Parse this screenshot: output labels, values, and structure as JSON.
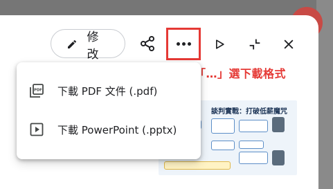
{
  "toolbar": {
    "edit_label": "修改",
    "icons": [
      "pencil-icon",
      "share-icon",
      "more-icon",
      "play-icon",
      "minimize-icon",
      "close-icon"
    ]
  },
  "annotation": "點擊「…」選下載格式",
  "menu": {
    "items": [
      {
        "label": "下載 PDF 文件 (.pdf)",
        "icon": "pdf-icon"
      },
      {
        "label": "下載 PowerPoint (.pptx)",
        "icon": "slideshow-icon"
      }
    ]
  },
  "slide": {
    "title": "談判實戰：打破低薪魔咒"
  },
  "colors": {
    "accent_red": "#e53935",
    "text": "#202124",
    "backdrop": "#7c7c7c"
  }
}
